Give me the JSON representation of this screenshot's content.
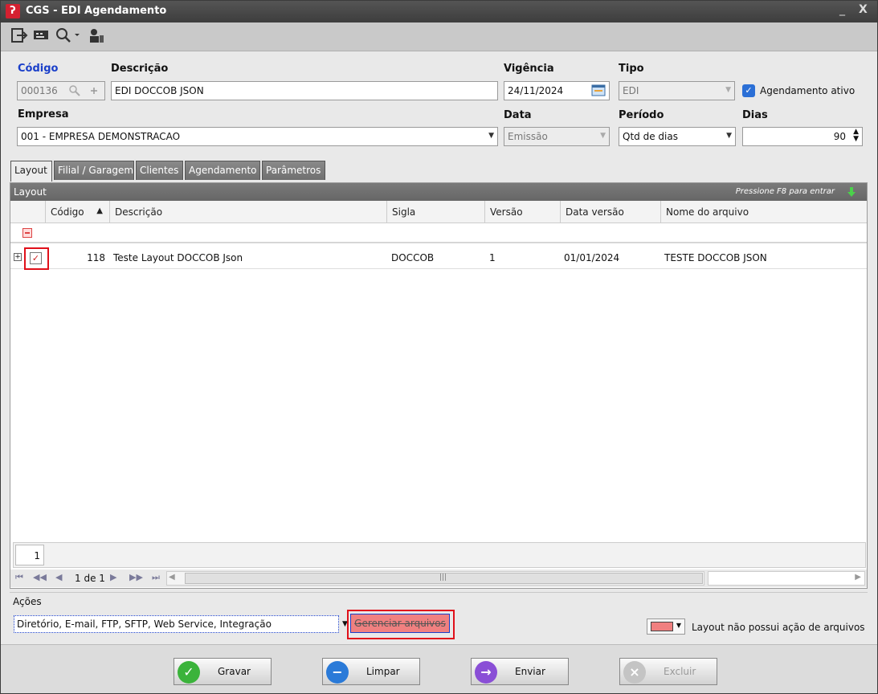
{
  "window": {
    "app_icon": "ʔ",
    "title": "CGS - EDI Agendamento",
    "minimize": "_",
    "close": "X"
  },
  "form": {
    "codigo_label": "Código",
    "codigo_value": "000136",
    "descricao_label": "Descrição",
    "descricao_value": "EDI DOCCOB JSON",
    "vigencia_label": "Vigência",
    "vigencia_value": "24/11/2024",
    "tipo_label": "Tipo",
    "tipo_value": "EDI",
    "agendamento_ativo_label": "Agendamento ativo",
    "empresa_label": "Empresa",
    "empresa_value": "001 - EMPRESA DEMONSTRACAO",
    "data_label": "Data",
    "data_value": "Emissão",
    "periodo_label": "Período",
    "periodo_value": "Qtd de dias",
    "dias_label": "Dias",
    "dias_value": "90"
  },
  "tabs": [
    {
      "label": "Layout"
    },
    {
      "label": "Filial / Garagem"
    },
    {
      "label": "Clientes"
    },
    {
      "label": "Agendamento"
    },
    {
      "label": "Parâmetros"
    }
  ],
  "layout_panel": {
    "title": "Layout",
    "hint": "Pressione F8 para entrar",
    "columns": [
      "Código",
      "Descrição",
      "Sigla",
      "Versão",
      "Data versão",
      "Nome do arquivo"
    ],
    "rows": [
      {
        "codigo": "118",
        "descricao": "Teste Layout DOCCOB Json",
        "sigla": "DOCCOB",
        "versao": "1",
        "data_versao": "01/01/2024",
        "nome_arquivo": "TESTE DOCCOB JSON"
      }
    ],
    "page_number": "1",
    "page_info": "1 de 1"
  },
  "acoes": {
    "label": "Ações",
    "value": "Diretório, E-mail, FTP, SFTP, Web Service, Integração",
    "gerenciar_label": "Gerenciar arquivos",
    "legend_label": "Layout não possui ação de arquivos",
    "legend_color": "#f08080"
  },
  "buttons": {
    "gravar": "Gravar",
    "limpar": "Limpar",
    "enviar": "Enviar",
    "excluir": "Excluir"
  },
  "colors": {
    "accent_blue": "#1a3fc9",
    "highlight_red": "#e0101a",
    "gravar_green": "#3bb33b",
    "limpar_blue": "#2a7ad8",
    "enviar_purple": "#8a4fd6"
  }
}
